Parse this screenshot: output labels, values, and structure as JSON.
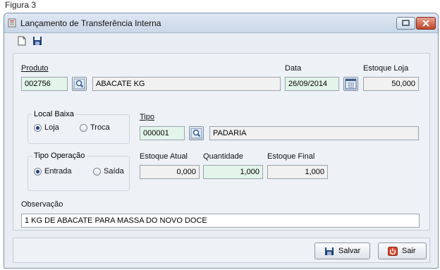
{
  "figure_caption": "Figura 3",
  "window": {
    "title": "Lançamento de Transferência Interna"
  },
  "toolbar": {
    "new_icon": "new-document-icon",
    "save_icon": "floppy-disk-icon"
  },
  "produto": {
    "label": "Produto",
    "code": "002756",
    "description": "ABACATE KG"
  },
  "data": {
    "label": "Data",
    "value": "26/09/2014",
    "calendar_icon": "calendar-icon"
  },
  "estoque_loja": {
    "label": "Estoque Loja",
    "value": "50,000"
  },
  "local_baixa": {
    "title": "Local Baixa",
    "options": [
      "Loja",
      "Troca"
    ],
    "selected": "Loja"
  },
  "tipo": {
    "label": "Tipo",
    "code": "000001",
    "description": "PADARIA"
  },
  "tipo_operacao": {
    "title": "Tipo Operação",
    "options": [
      "Entrada",
      "Saída"
    ],
    "selected": "Entrada"
  },
  "estoque_atual": {
    "label": "Estoque Atual",
    "value": "0,000"
  },
  "quantidade": {
    "label": "Quantidade",
    "value": "1,000"
  },
  "estoque_final": {
    "label": "Estoque Final",
    "value": "1,000"
  },
  "observacao": {
    "label": "Observação",
    "value": "1 KG DE ABACATE PARA MASSA DO NOVO DOCE"
  },
  "buttons": {
    "salvar": "Salvar",
    "sair": "Sair"
  },
  "colors": {
    "editable_field": "#e3f5ea",
    "readonly_field": "#f1f1f1",
    "close_button": "#c3452b"
  }
}
